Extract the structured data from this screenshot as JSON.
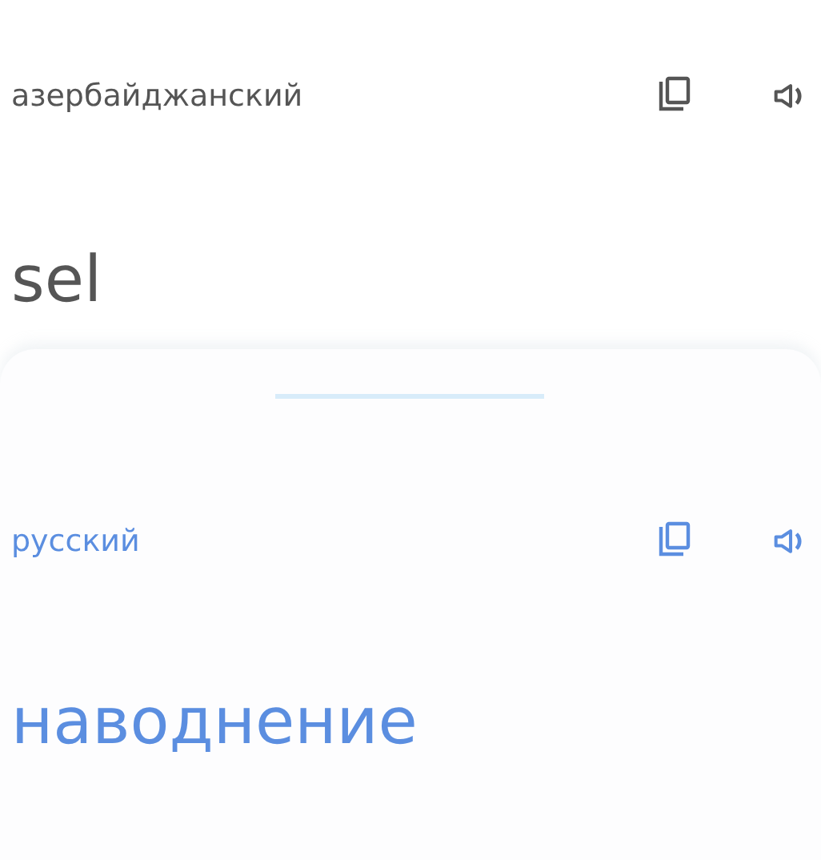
{
  "source": {
    "language": "азербайджанский",
    "text": "sel"
  },
  "target": {
    "language": "русский",
    "text": "наводнение"
  }
}
